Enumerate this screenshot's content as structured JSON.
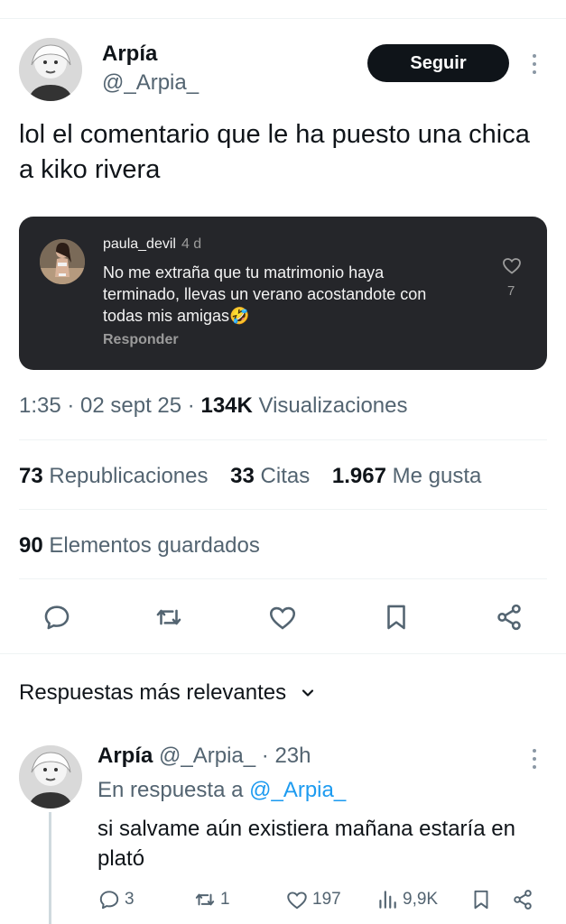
{
  "tweet": {
    "author_name": "Arpía",
    "author_handle": "@_Arpia_",
    "follow_label": "Seguir",
    "text": "lol el comentario que le ha puesto una chica a kiko rivera",
    "time": "1:35 · 02 sept 25 · ",
    "views_count": "134K",
    "views_label": "Visualizaciones"
  },
  "embedded_comment": {
    "username": "paula_devil",
    "time": "4 d",
    "text": "No me extraña que tu matrimonio haya terminado, llevas un verano acostandote con todas mis amigas🤣",
    "reply_label": "Responder",
    "likes": "7"
  },
  "stats": {
    "reposts_count": "73",
    "reposts_label": "Republicaciones",
    "quotes_count": "33",
    "quotes_label": "Citas",
    "likes_count": "1.967",
    "likes_label": "Me gusta",
    "saved_count": "90",
    "saved_label": "Elementos guardados"
  },
  "actions": {
    "icons": [
      "reply-icon",
      "repost-icon",
      "like-icon",
      "bookmark-icon",
      "share-icon"
    ]
  },
  "replies_section": {
    "title": "Respuestas más relevantes"
  },
  "reply": {
    "author_name": "Arpía",
    "author_handle": "@_Arpia_",
    "time": "· 23h",
    "reply_to_prefix": "En respuesta a",
    "reply_to_handle": "@_Arpia_",
    "text": "si salvame aún existiera mañana estaría en plató",
    "replies": "3",
    "reposts": "1",
    "likes": "197",
    "views": "9,9K"
  },
  "colors": {
    "text": "#0f1419",
    "secondary": "#536471",
    "link": "#1d9bf0",
    "card_bg": "#25262a"
  }
}
